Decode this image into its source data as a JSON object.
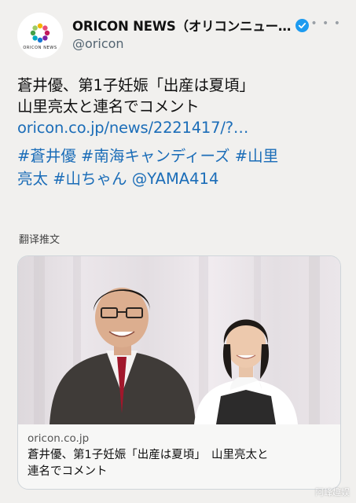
{
  "account": {
    "display_name": "ORICON NEWS（オリコンニュー…",
    "handle": "@oricon",
    "logo_text": "ORICON NEWS",
    "verified_icon": "verified-badge-icon",
    "more_icon": "more-dots-icon"
  },
  "tweet": {
    "line1": "蒼井優、第1子妊娠「出産は夏頃」",
    "line2": "山里亮太と連名でコメント",
    "link": "oricon.co.jp/news/2221417/?…",
    "hashtags_line1": "#蒼井優 #南海キャンディーズ #山里",
    "hashtags_line2": "亮太 #山ちゃん @YAMA414"
  },
  "translate_label": "翻译推文",
  "card": {
    "domain": "oricon.co.jp",
    "title_line1": "蒼井優、第1子妊娠「出産は夏頃」　山里亮太と",
    "title_line2": "連名でコメント"
  },
  "watermark": "阿峰趣娱",
  "colors": {
    "link": "#1b6db8",
    "verified": "#1d9bf0",
    "background": "#f1f0ee"
  }
}
